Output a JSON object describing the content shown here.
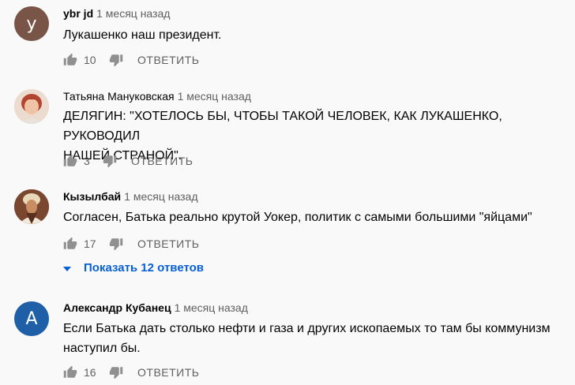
{
  "comments": [
    {
      "author": "ybr jd",
      "date": "1 месяц назад",
      "avatar_letter": "y",
      "avatar_color": "#795548",
      "lines": [
        "Лукашенко наш президент."
      ],
      "likes": "10",
      "reply_label": "ОТВЕТИТЬ"
    },
    {
      "author": "Татьяна Мануковская",
      "date": "1 месяц назад",
      "avatar_color": "#d8a48a",
      "lines": [
        "ДЕЛЯГИН: \"ХОТЕЛОСЬ БЫ, ЧТОБЫ ТАКОЙ ЧЕЛОВЕК, КАК ЛУКАШЕНКО, РУКОВОДИЛ",
        "НАШЕЙ СТРАНОЙ\"."
      ],
      "likes": "3",
      "reply_label": "ОТВЕТИТЬ"
    },
    {
      "author": "Кызылбай",
      "date": "1 месяц назад",
      "avatar_color": "#6b3a2a",
      "lines": [
        "Согласен, Батька реально крутой Уокер, политик с самыми большими \"яйцами\""
      ],
      "likes": "17",
      "reply_label": "ОТВЕТИТЬ"
    },
    {
      "author": "Александр Кубанец",
      "date": "1 месяц назад",
      "avatar_letter": "A",
      "avatar_color": "#1e5fa8",
      "lines": [
        "Если Батька дать столько нефти и газа и других ископаемых то там бы коммунизм",
        "наступил бы."
      ],
      "likes": "16",
      "reply_label": "ОТВЕТИТЬ"
    }
  ],
  "show_replies": {
    "label": "Показать 12 ответов"
  },
  "colors": {
    "accent": "#065fd4",
    "secondary_text": "#606060",
    "icon": "#909090"
  },
  "icons": {
    "like": "thumb-up-icon",
    "dislike": "thumb-down-icon",
    "expand": "chevron-down-icon"
  }
}
